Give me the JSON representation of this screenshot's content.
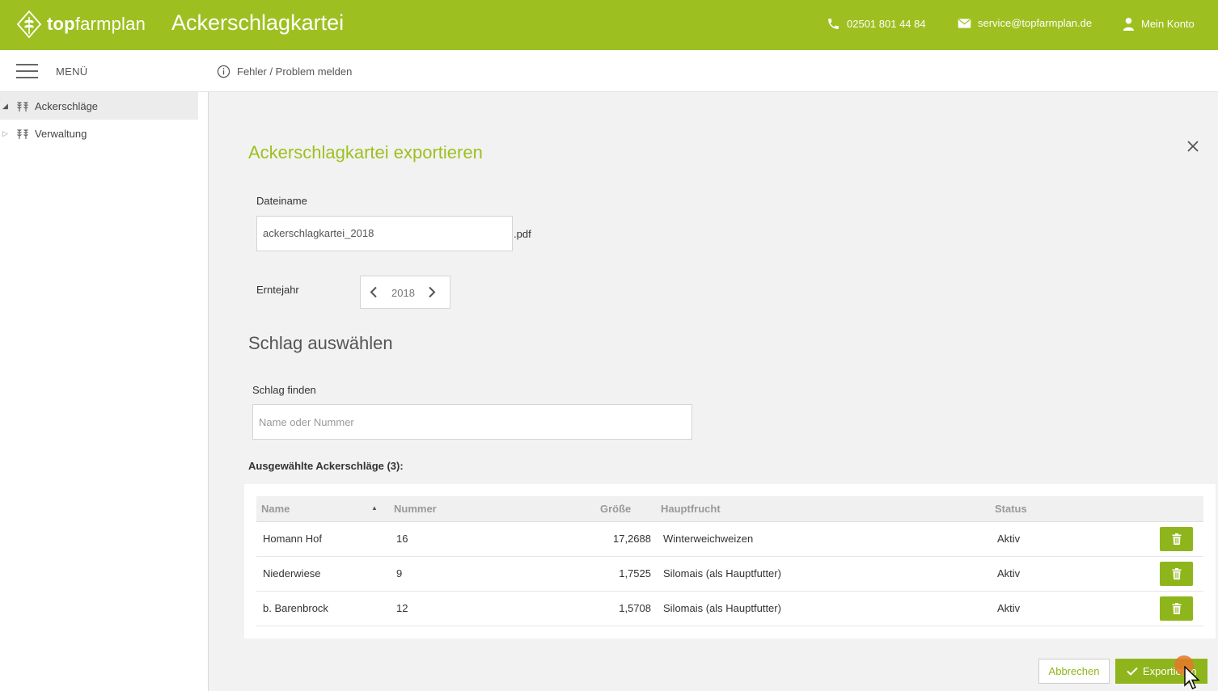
{
  "header": {
    "logo_bold": "top",
    "logo_light": "farmplan",
    "app_title": "Ackerschlagkartei",
    "phone": "02501 801 44 84",
    "email": "service@topfarmplan.de",
    "account": "Mein Konto",
    "color": "#9dc020"
  },
  "toolbar": {
    "menu_label": "MENÜ",
    "report_label": "Fehler / Problem melden"
  },
  "sidebar": {
    "items": [
      {
        "label": "Ackerschläge",
        "expanded": true,
        "active": true
      },
      {
        "label": "Verwaltung",
        "expanded": false,
        "active": false
      }
    ]
  },
  "dialog": {
    "title": "Ackerschlagkartei exportieren",
    "filename_label": "Dateiname",
    "filename_value": "ackerschlagkartei_2018",
    "filename_ext": ".pdf",
    "year_label": "Erntejahr",
    "year_value": "2018",
    "section_title": "Schlag auswählen",
    "find_label": "Schlag finden",
    "find_placeholder": "Name oder Nummer",
    "selected_heading": "Ausgewählte Ackerschläge (3):",
    "table": {
      "columns": [
        "Name",
        "Nummer",
        "Größe",
        "Hauptfrucht",
        "Status"
      ],
      "sort_column": "Name",
      "rows": [
        {
          "name": "Homann Hof",
          "number": "16",
          "size": "17,2688",
          "crop": "Winterweichweizen",
          "status": "Aktiv"
        },
        {
          "name": "Niederwiese",
          "number": "9",
          "size": "1,7525",
          "crop": "Silomais (als Hauptfutter)",
          "status": "Aktiv"
        },
        {
          "name": "b. Barenbrock",
          "number": "12",
          "size": "1,5708",
          "crop": "Silomais (als Hauptfutter)",
          "status": "Aktiv"
        }
      ]
    },
    "cancel_label": "Abbrechen",
    "export_label": "Exportieren"
  }
}
